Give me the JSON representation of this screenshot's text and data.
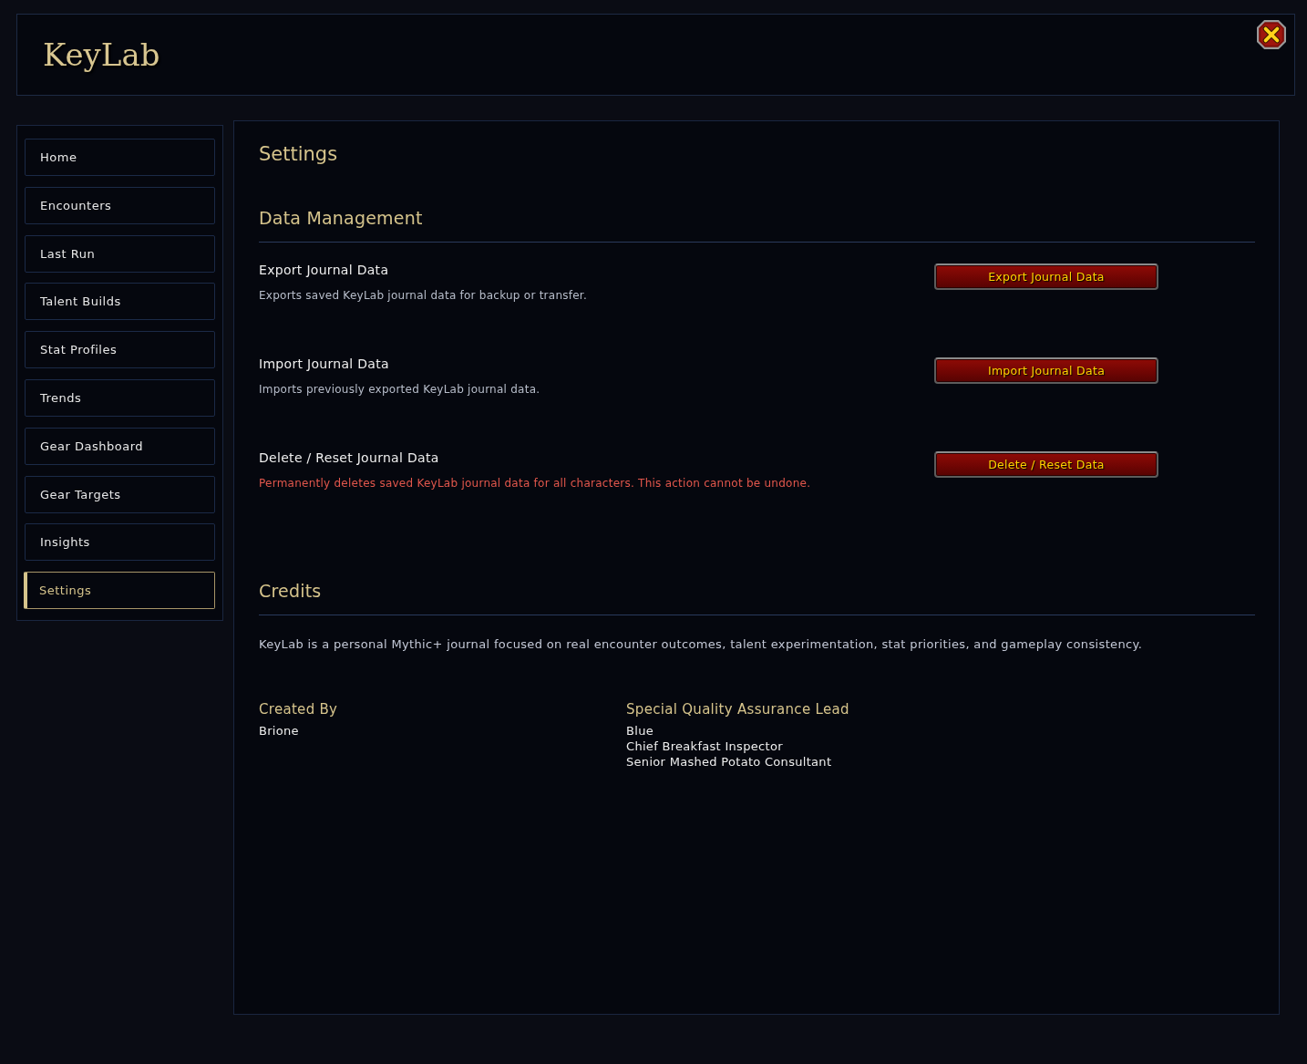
{
  "app": {
    "title": "KeyLab"
  },
  "sidebar": {
    "items": [
      {
        "label": "Home",
        "selected": false
      },
      {
        "label": "Encounters",
        "selected": false
      },
      {
        "label": "Last Run",
        "selected": false
      },
      {
        "label": "Talent Builds",
        "selected": false
      },
      {
        "label": "Stat Profiles",
        "selected": false
      },
      {
        "label": "Trends",
        "selected": false
      },
      {
        "label": "Gear Dashboard",
        "selected": false
      },
      {
        "label": "Gear Targets",
        "selected": false
      },
      {
        "label": "Insights",
        "selected": false
      },
      {
        "label": "Settings",
        "selected": true
      }
    ]
  },
  "page": {
    "title": "Settings"
  },
  "sections": [
    {
      "kind": "actions",
      "title": "Data Management",
      "rows": [
        {
          "label": "Export Journal Data",
          "description": "Exports saved KeyLab journal data for backup or transfer.",
          "danger": false,
          "button": "Export Journal Data"
        },
        {
          "label": "Import Journal Data",
          "description": "Imports previously exported KeyLab journal data.",
          "danger": false,
          "button": "Import Journal Data"
        },
        {
          "label": "Delete / Reset Journal Data",
          "description": "Permanently deletes saved KeyLab journal data for all characters. This action cannot be undone.",
          "danger": true,
          "button": "Delete / Reset Data"
        }
      ]
    },
    {
      "kind": "credits",
      "title": "Credits",
      "text": "KeyLab is a personal Mythic+ journal focused on real encounter outcomes, talent experimentation, stat priorities, and gameplay consistency.",
      "groups": [
        {
          "heading": "Created By",
          "names": [
            "Brione"
          ]
        },
        {
          "heading": "Special Quality Assurance Lead",
          "names": [
            "Blue",
            "Chief Breakfast Inspector",
            "Senior Mashed Potato Consultant"
          ]
        }
      ]
    }
  ]
}
